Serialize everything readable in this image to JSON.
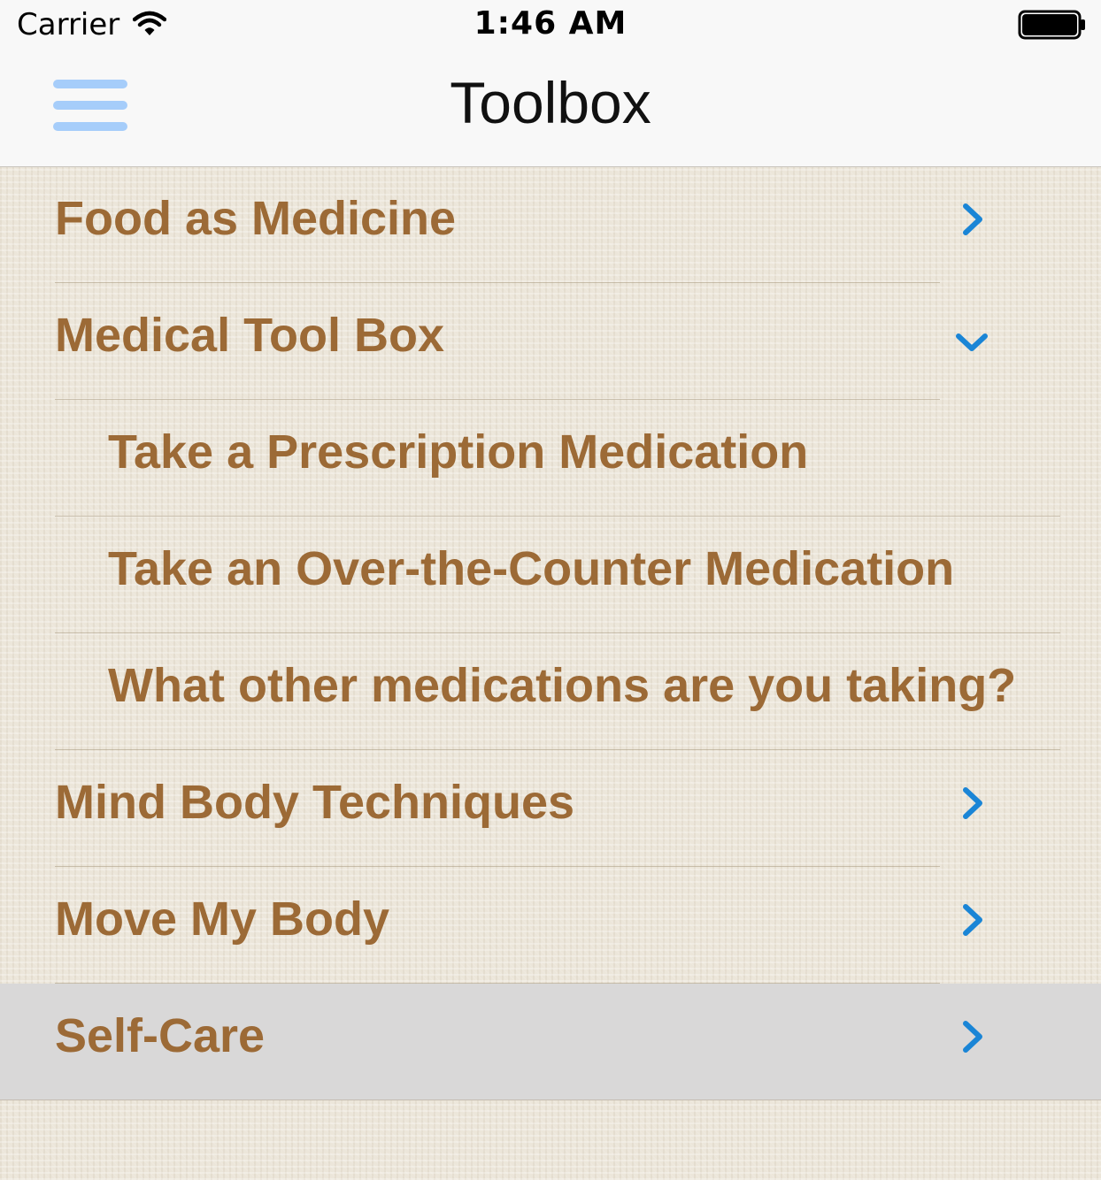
{
  "status_bar": {
    "carrier": "Carrier",
    "time": "1:46 AM"
  },
  "nav": {
    "title": "Toolbox",
    "menu_icon": "hamburger-icon"
  },
  "colors": {
    "item_text": "#9c6a36",
    "chevron": "#1a85d6",
    "menu_icon": "#a6cdfa",
    "selected_row": "#d9d8d8"
  },
  "items": [
    {
      "label": "Food as Medicine",
      "icon": "chevron-right-icon"
    },
    {
      "label": "Medical Tool Box",
      "icon": "chevron-down-icon",
      "expanded": true
    },
    {
      "label": "Take a Prescription Medication",
      "sub": true
    },
    {
      "label": "Take an Over-the-Counter Medication",
      "sub": true
    },
    {
      "label": "What other medications are you taking?",
      "sub": true
    },
    {
      "label": "Mind Body Techniques",
      "icon": "chevron-right-icon"
    },
    {
      "label": "Move My Body",
      "icon": "chevron-right-icon"
    },
    {
      "label": "Self-Care",
      "icon": "chevron-right-icon",
      "selected": true
    }
  ]
}
